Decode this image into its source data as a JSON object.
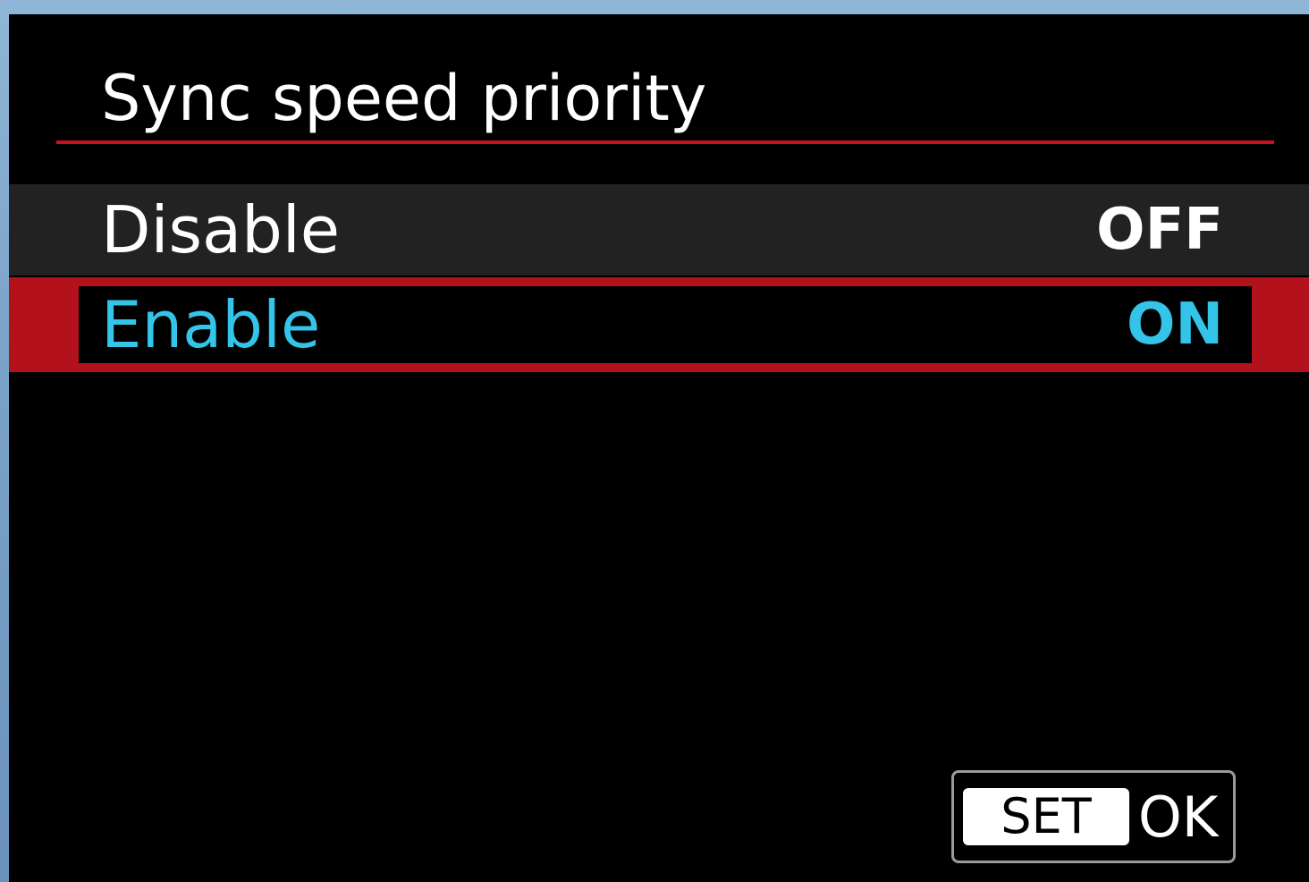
{
  "menu": {
    "title": "Sync speed priority",
    "options": [
      {
        "label": "Disable",
        "value": "OFF",
        "selected": false
      },
      {
        "label": "Enable",
        "value": "ON",
        "selected": true
      }
    ]
  },
  "footer": {
    "set_label": "SET",
    "ok_label": "OK"
  },
  "colors": {
    "accent": "#c8101f",
    "selected_text": "#33c4e8",
    "background": "#000000"
  }
}
